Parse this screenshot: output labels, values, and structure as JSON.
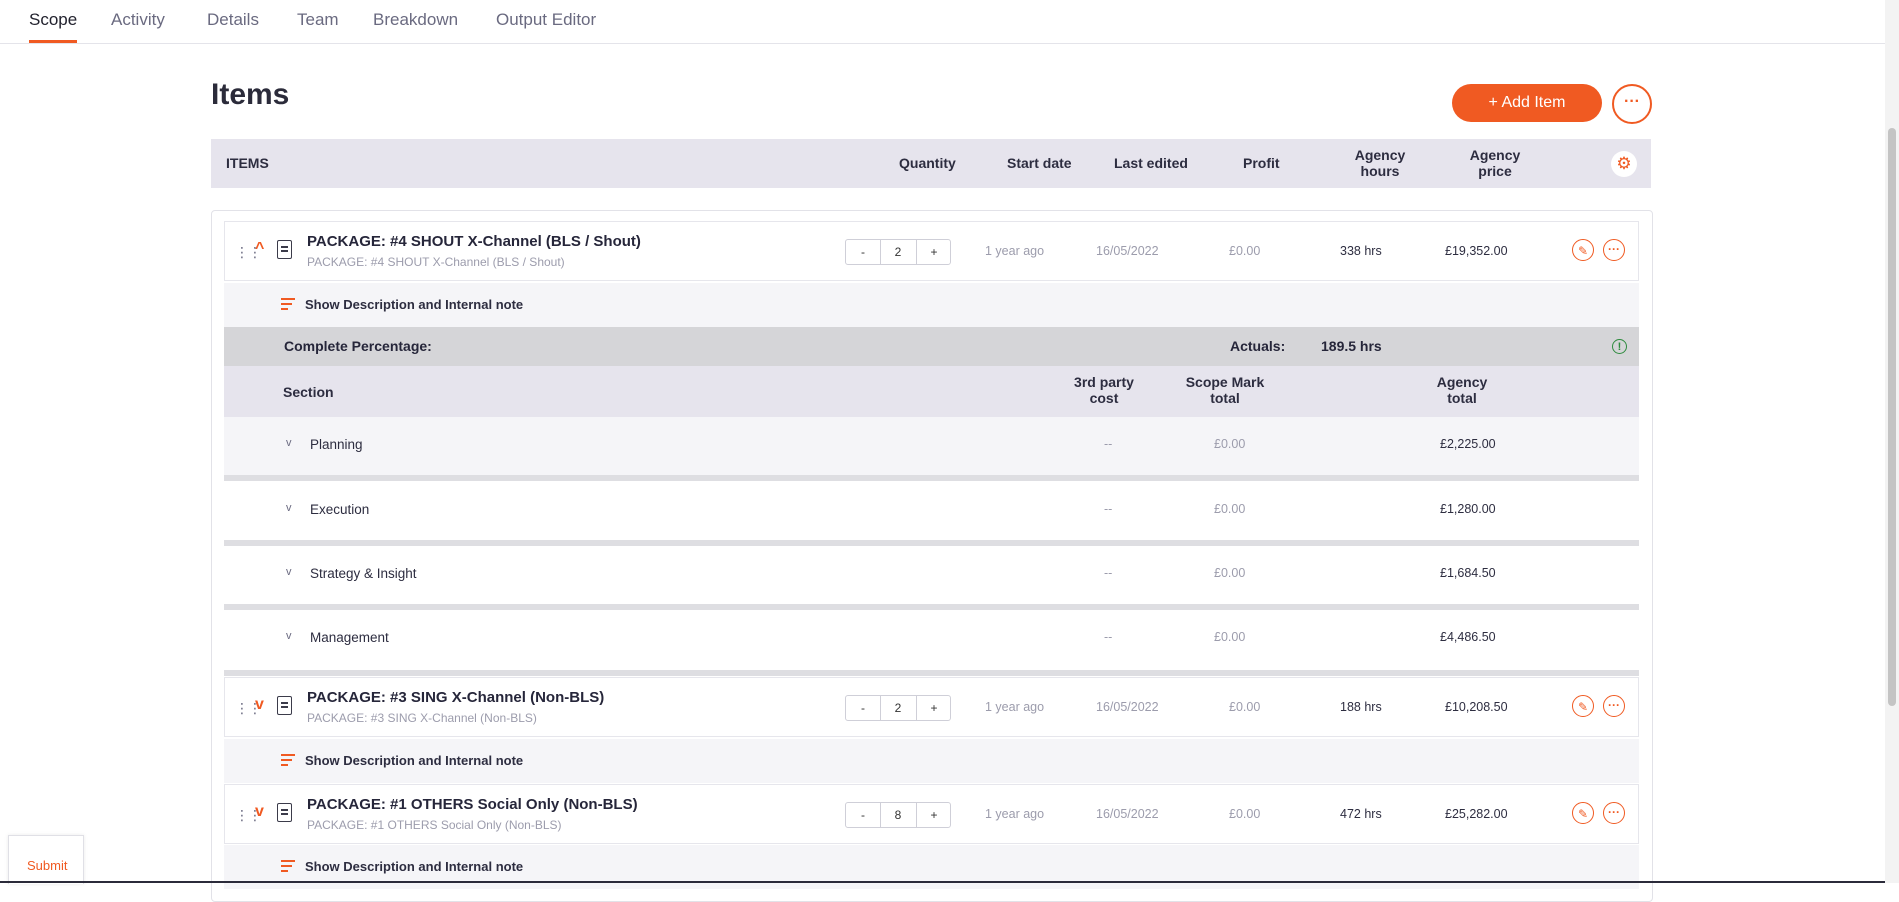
{
  "tabs": [
    {
      "label": "Scope",
      "active": true
    },
    {
      "label": "Activity"
    },
    {
      "label": "Details"
    },
    {
      "label": "Team"
    },
    {
      "label": "Breakdown"
    },
    {
      "label": "Output Editor"
    }
  ],
  "header": {
    "title": "Items",
    "add_label": "+ Add Item",
    "more_glyph": "···"
  },
  "columns": {
    "items": "ITEMS",
    "quantity": "Quantity",
    "start_date": "Start date",
    "last_edited": "Last edited",
    "profit": "Profit",
    "agency_hours": [
      "Agency",
      "hours"
    ],
    "agency_price": [
      "Agency",
      "price"
    ]
  },
  "items": [
    {
      "title": "PACKAGE: #4 SHOUT X-Channel (BLS / Shout)",
      "subtitle": "PACKAGE: #4 SHOUT X-Channel (BLS / Shout)",
      "quantity": "2",
      "start": "1 year ago",
      "edited": "16/05/2022",
      "profit": "£0.00",
      "hours": "338 hrs",
      "price": "£19,352.00",
      "expanded": true,
      "desc_label": "Show Description and Internal note"
    },
    {
      "title": "PACKAGE: #3 SING X-Channel (Non-BLS)",
      "subtitle": "PACKAGE: #3 SING X-Channel (Non-BLS)",
      "quantity": "2",
      "start": "1 year ago",
      "edited": "16/05/2022",
      "profit": "£0.00",
      "hours": "188 hrs",
      "price": "£10,208.50",
      "expanded": false,
      "desc_label": "Show Description and Internal note"
    },
    {
      "title": "PACKAGE: #1 OTHERS Social Only (Non-BLS)",
      "subtitle": "PACKAGE: #1 OTHERS Social Only (Non-BLS)",
      "quantity": "8",
      "start": "1 year ago",
      "edited": "16/05/2022",
      "profit": "£0.00",
      "hours": "472 hrs",
      "price": "£25,282.00",
      "expanded": false,
      "desc_label": "Show Description and Internal note"
    }
  ],
  "complete": {
    "label": "Complete Percentage:",
    "actuals_label": "Actuals:",
    "actuals_value": "189.5 hrs"
  },
  "section_columns": {
    "section": "Section",
    "third_party": [
      "3rd party",
      "cost"
    ],
    "scope_mark": [
      "Scope Mark",
      "total"
    ],
    "agency_total": [
      "Agency",
      "total"
    ]
  },
  "sections": [
    {
      "name": "Planning",
      "third_party": "--",
      "scope_mark": "£0.00",
      "agency_total": "£2,225.00"
    },
    {
      "name": "Execution",
      "third_party": "--",
      "scope_mark": "£0.00",
      "agency_total": "£1,280.00"
    },
    {
      "name": "Strategy & Insight",
      "third_party": "--",
      "scope_mark": "£0.00",
      "agency_total": "£1,684.50"
    },
    {
      "name": "Management",
      "third_party": "--",
      "scope_mark": "£0.00",
      "agency_total": "£4,486.50"
    }
  ],
  "submit_label": "Submit",
  "colors": {
    "accent": "#f05a22",
    "header_bg": "#e6e4ed",
    "success": "#2e8b3e"
  },
  "icons": {
    "drag": "drag-handle-icon",
    "document": "document-icon",
    "edit": "pencil-icon",
    "more": "ellipsis-icon",
    "settings": "gear-icon",
    "ok": "info-circle-icon"
  }
}
